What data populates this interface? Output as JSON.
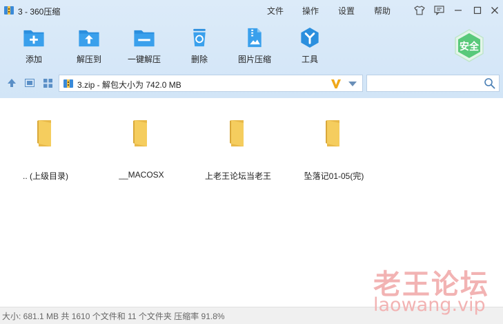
{
  "window": {
    "title": "3 - 360压缩",
    "menus": [
      "文件",
      "操作",
      "设置",
      "帮助"
    ]
  },
  "toolbar": {
    "tools": [
      {
        "label": "添加",
        "icon": "add-icon"
      },
      {
        "label": "解压到",
        "icon": "extract-to-icon"
      },
      {
        "label": "一键解压",
        "icon": "one-click-extract-icon"
      },
      {
        "label": "删除",
        "icon": "delete-icon"
      },
      {
        "label": "图片压缩",
        "icon": "image-compress-icon"
      },
      {
        "label": "工具",
        "icon": "tools-icon"
      }
    ],
    "safe_badge": "安全"
  },
  "address": {
    "path": "3.zip - 解包大小为 742.0 MB",
    "search_placeholder": ""
  },
  "files": [
    {
      "name": ".. (上级目录)"
    },
    {
      "name": "__MACOSX"
    },
    {
      "name": "上老王论坛当老王"
    },
    {
      "name": "坠落记01-05(完)"
    }
  ],
  "status": {
    "text": "大小: 681.1 MB 共 1610 个文件和 11 个文件夹 压缩率 91.8%"
  },
  "watermark": {
    "cn": "老王论坛",
    "en": "laowang.vip"
  },
  "colors": {
    "chrome_bg": "#d7e8f8",
    "tool_blue": "#2b8fde",
    "folder_yellow": "#f5cd5e",
    "safe_green": "#59c97a",
    "watermark": "#f2b3b3",
    "v_orange": "#f0a81a"
  }
}
